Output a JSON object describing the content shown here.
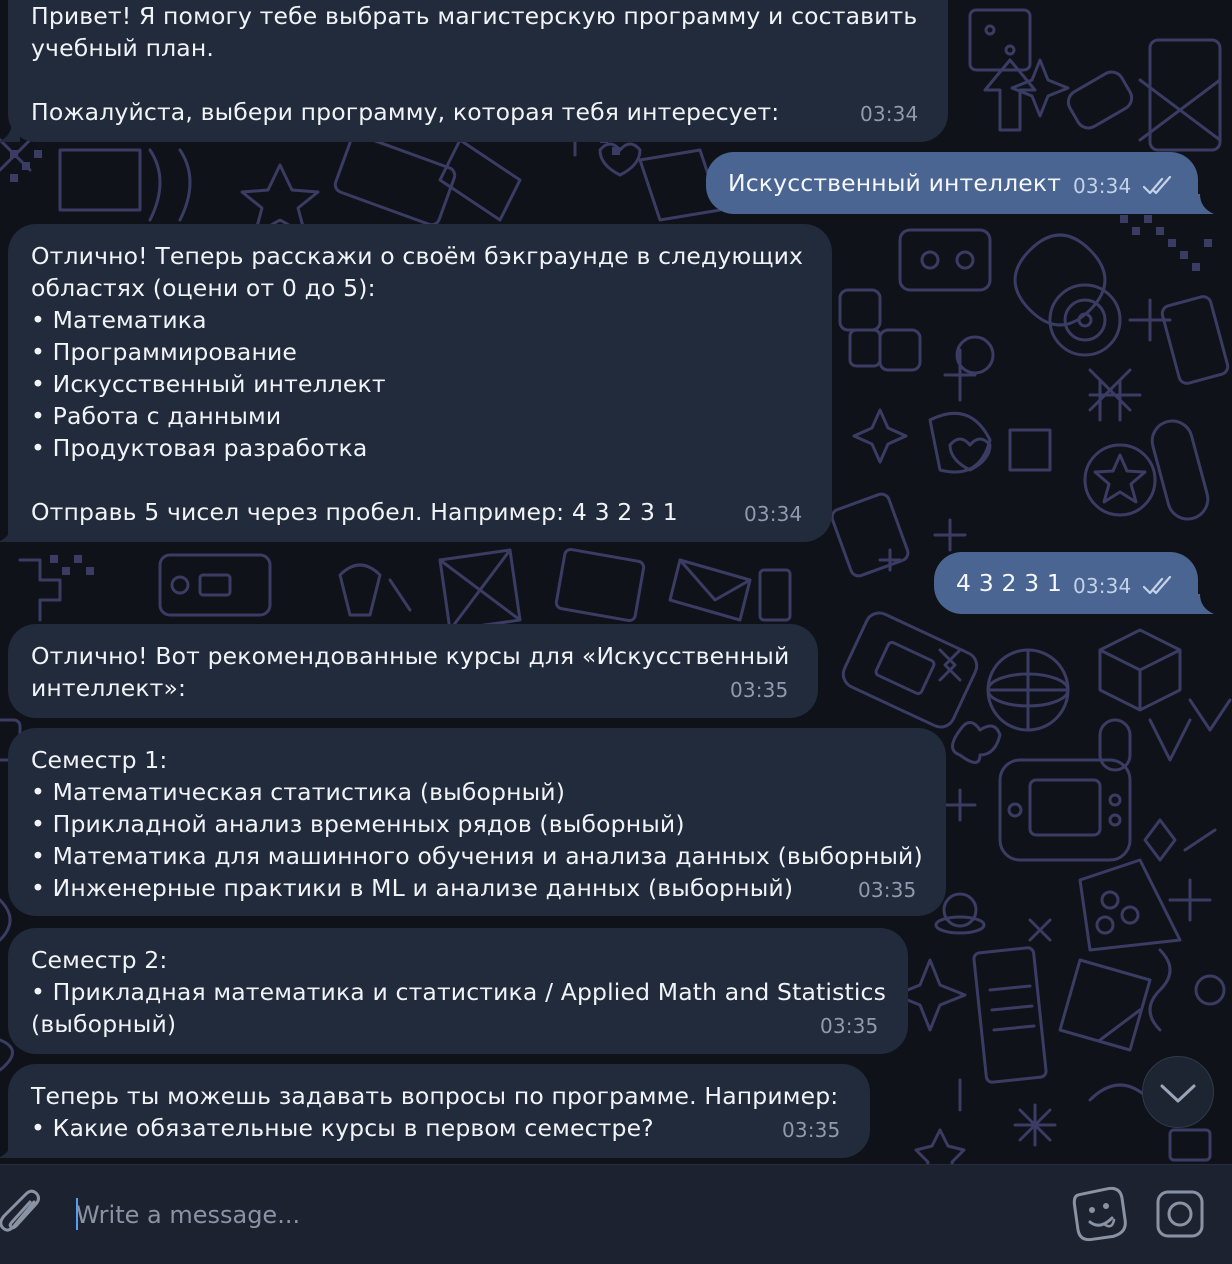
{
  "messages": [
    {
      "id": "bot-1",
      "direction": "incoming",
      "text": "Привет! Я помогу тебе выбрать магистерскую программу и составить\nучебный план.\n\nПожалуйста, выбери программу, которая тебя интересует:",
      "time": "03:34"
    },
    {
      "id": "user-1",
      "direction": "outgoing",
      "text": "Искусственный интеллект",
      "time": "03:34",
      "status": "read"
    },
    {
      "id": "bot-2",
      "direction": "incoming",
      "text": "Отлично! Теперь расскажи о своём бэкграунде в следующих\nобластях (оцени от 0 до 5):\n• Математика\n• Программирование\n• Искусственный интеллект\n• Работа с данными\n• Продуктовая разработка\n\nОтправь 5 чисел через пробел. Например: 4 3 2 3 1",
      "time": "03:34"
    },
    {
      "id": "user-2",
      "direction": "outgoing",
      "text": "4 3 2 3 1",
      "time": "03:34",
      "status": "read"
    },
    {
      "id": "bot-3",
      "direction": "incoming",
      "text": "Отлично! Вот рекомендованные курсы для «Искусственный\nинтеллект»:",
      "time": "03:35"
    },
    {
      "id": "bot-4",
      "direction": "incoming",
      "text": "Семестр 1:\n• Математическая статистика (выборный)\n• Прикладной анализ временных рядов (выборный)\n• Математика для машинного обучения и анализа данных (выборный)\n• Инженерные практики в ML и анализе данных (выборный)",
      "time": "03:35"
    },
    {
      "id": "bot-5",
      "direction": "incoming",
      "text": "Семестр 2:\n• Прикладная математика и статистика / Applied Math and Statistics\n(выборный)",
      "time": "03:35"
    },
    {
      "id": "bot-6",
      "direction": "incoming",
      "text": "Теперь ты можешь задавать вопросы по программе. Например:\n• Какие обязательные курсы в первом семестре?",
      "time": "03:35"
    }
  ],
  "composer": {
    "placeholder": "Write a message...",
    "value": ""
  },
  "icons": {
    "attach": "paperclip-icon",
    "sticker": "sticker-icon",
    "camera": "camera-icon",
    "scroll": "chevron-down-icon",
    "read_status": "double-check-icon"
  },
  "colors": {
    "background": "#0f1218",
    "incoming_bubble": "#212b3b",
    "outgoing_bubble": "#4a6591",
    "composer": "#1d2230",
    "doodle_stroke": "#3a3c63",
    "caret": "#5a9cf0"
  }
}
